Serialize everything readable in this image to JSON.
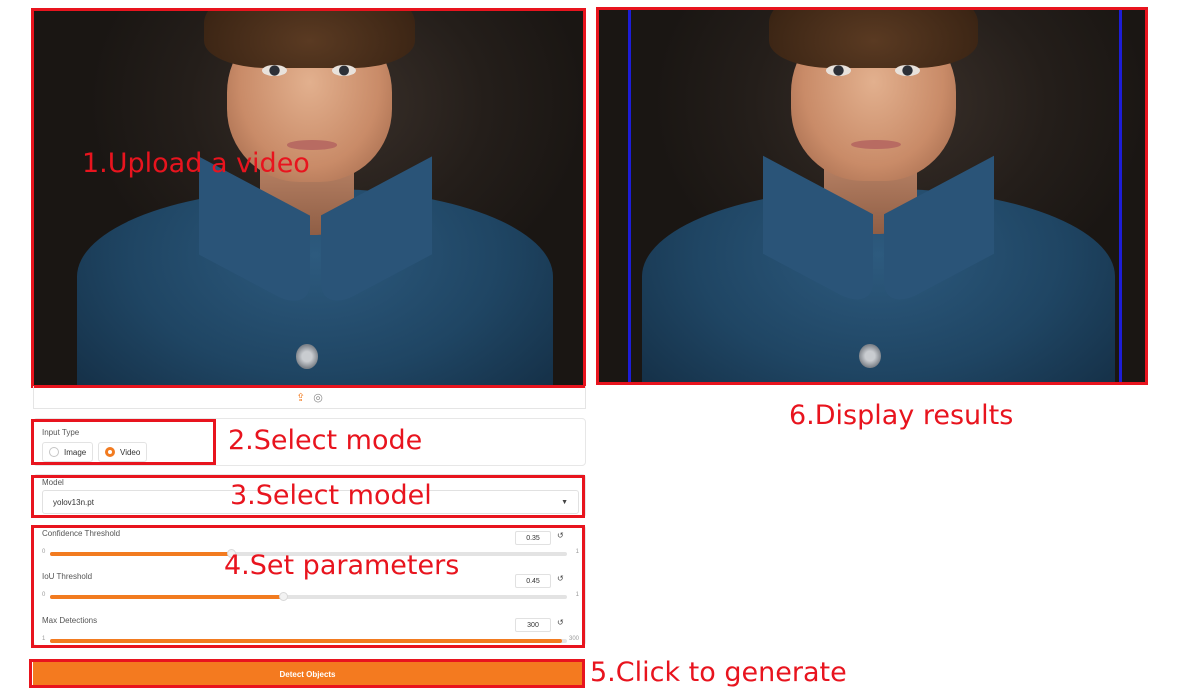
{
  "annotations": {
    "upload": "1.Upload a video",
    "mode": "2.Select mode",
    "model": "3.Select model",
    "params": "4.Set parameters",
    "generate": "5.Click to generate",
    "display": "6.Display results"
  },
  "input_type": {
    "label": "Input Type",
    "options": [
      "Image",
      "Video"
    ],
    "selected": "Video"
  },
  "model": {
    "label": "Model",
    "value": "yolov13n.pt"
  },
  "params": {
    "confidence": {
      "label": "Confidence Threshold",
      "value": "0.35",
      "min": "0",
      "max": "1",
      "fraction": 0.35
    },
    "iou": {
      "label": "IoU Threshold",
      "value": "0.45",
      "min": "0",
      "max": "1",
      "fraction": 0.45
    },
    "max_det": {
      "label": "Max Detections",
      "value": "300",
      "min": "1",
      "max": "300",
      "fraction": 1.0
    }
  },
  "detect_button": "Detect Objects",
  "icons": {
    "upload": "upload-icon",
    "webcam": "webcam-icon",
    "reset": "reset-icon",
    "dropdown": "chevron-down-icon"
  },
  "colors": {
    "accent": "#f27b20",
    "annotation": "#e8141e",
    "detection_box": "#1d1dd6"
  }
}
